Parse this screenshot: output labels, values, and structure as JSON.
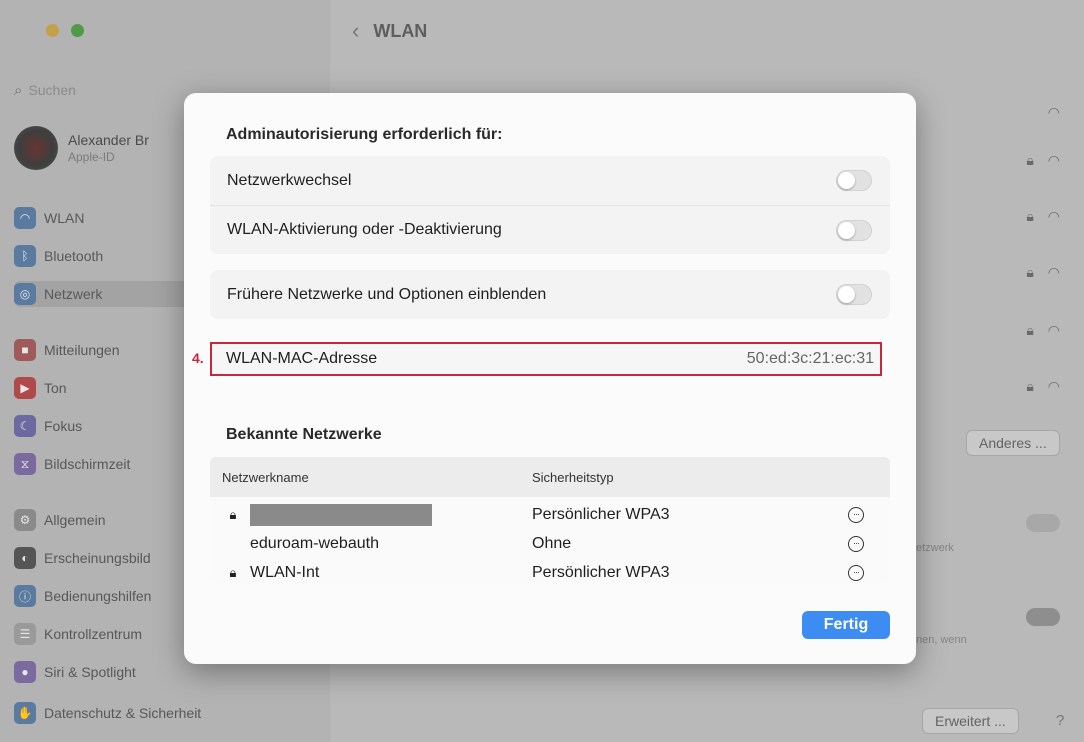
{
  "window": {
    "title": "WLAN",
    "search_placeholder": "Suchen",
    "user": {
      "name": "Alexander Br",
      "sub": "Apple-ID"
    },
    "sidebar": [
      {
        "label": "WLAN",
        "icon": "wifi-icon"
      },
      {
        "label": "Bluetooth",
        "icon": "bluetooth-icon"
      },
      {
        "label": "Netzwerk",
        "icon": "globe-icon"
      },
      {
        "label": "Mitteilungen",
        "icon": "bell-icon"
      },
      {
        "label": "Ton",
        "icon": "speaker-icon"
      },
      {
        "label": "Fokus",
        "icon": "moon-icon"
      },
      {
        "label": "Bildschirmzeit",
        "icon": "hourglass-icon"
      },
      {
        "label": "Allgemein",
        "icon": "gear-icon"
      },
      {
        "label": "Erscheinungsbild",
        "icon": "appearance-icon"
      },
      {
        "label": "Bedienungshilfen",
        "icon": "accessibility-icon"
      },
      {
        "label": "Kontrollzentrum",
        "icon": "control-center-icon"
      },
      {
        "label": "Siri & Spotlight",
        "icon": "siri-icon"
      },
      {
        "label": "Datenschutz & Sicherheit",
        "icon": "hand-icon"
      }
    ],
    "other_button": "Anderes ...",
    "bg_text_1": "etzwerk",
    "bg_text_2": "nen, wenn",
    "advanced_button": "Erweitert ...",
    "help_button": "?"
  },
  "dialog": {
    "heading": "Adminautorisierung erforderlich für:",
    "toggles": [
      {
        "label": "Netzwerkwechsel"
      },
      {
        "label": "WLAN-Aktivierung oder -Deaktivierung"
      },
      {
        "label": "Frühere Netzwerke und Optionen einblenden"
      }
    ],
    "mac": {
      "step": "4.",
      "label": "WLAN-MAC-Adresse",
      "value": "50:ed:3c:21:ec:31"
    },
    "known_heading": "Bekannte Netzwerke",
    "table": {
      "col_name": "Netzwerkname",
      "col_security": "Sicherheitstyp",
      "rows": [
        {
          "name": "",
          "security": "Persönlicher WPA3"
        },
        {
          "name": "eduroam-webauth",
          "security": "Ohne"
        },
        {
          "name": "WLAN-Int",
          "security": "Persönlicher WPA3"
        }
      ]
    },
    "done_button": "Fertig"
  }
}
